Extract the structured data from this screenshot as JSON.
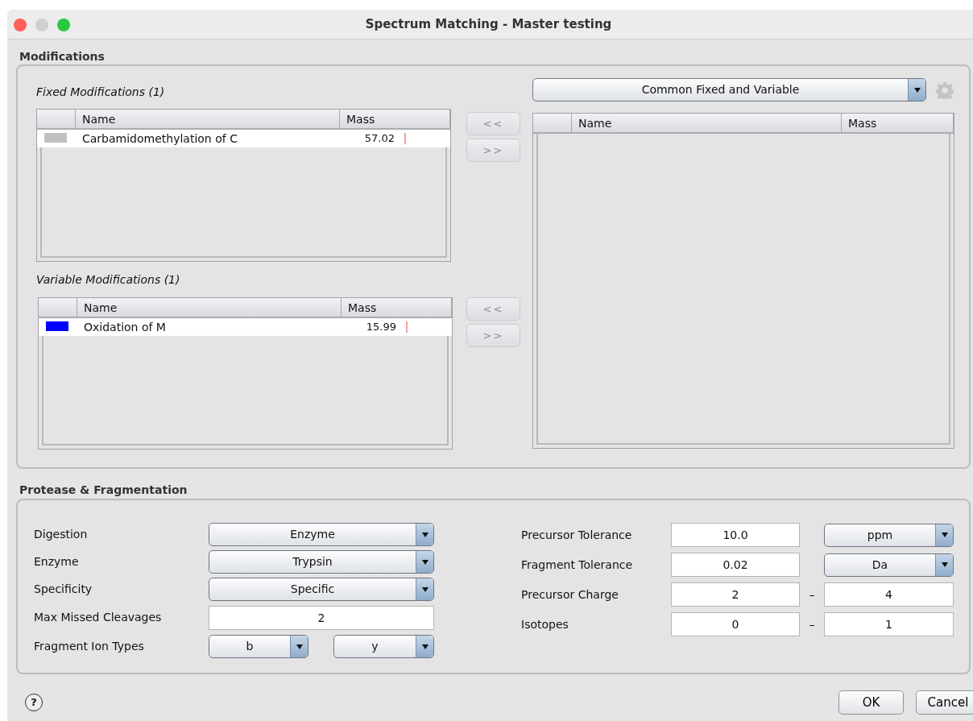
{
  "window": {
    "title": "Spectrum Matching - Master testing"
  },
  "modifications": {
    "title": "Modifications",
    "fixed": {
      "label": "Fixed Modifications (1)",
      "columns": [
        "Name",
        "Mass"
      ],
      "rows": [
        {
          "color": "#c0c0c0",
          "name": "Carbamidomethylation of C",
          "mass": "57.02"
        }
      ],
      "buttons": [
        {
          "label": "<<",
          "disabled": true
        },
        {
          "label": ">>",
          "disabled": true
        }
      ]
    },
    "variable": {
      "label": "Variable Modifications (1)",
      "columns": [
        "Name",
        "Mass"
      ],
      "rows": [
        {
          "color": "#0000ff",
          "name": "Oxidation of M",
          "mass": "15.99"
        }
      ],
      "buttons": [
        {
          "label": "<<",
          "disabled": true
        },
        {
          "label": ">>",
          "disabled": true
        }
      ]
    },
    "available": {
      "dropdown": "Common Fixed and Variable",
      "columns": [
        "Name",
        "Mass"
      ]
    }
  },
  "protease": {
    "title": "Protease & Fragmentation",
    "left": [
      {
        "kind": "combo",
        "label": "Digestion",
        "value": "Enzyme"
      },
      {
        "kind": "combo",
        "label": "Enzyme",
        "value": "Trypsin"
      },
      {
        "kind": "combo",
        "label": "Specificity",
        "value": "Specific"
      },
      {
        "kind": "field",
        "label": "Max Missed Cleavages",
        "value": "2"
      },
      {
        "kind": "pair",
        "label": "Fragment Ion Types",
        "values": [
          "b",
          "y"
        ]
      }
    ],
    "right": [
      {
        "kind": "unit",
        "label": "Precursor Tolerance",
        "value": "10.0",
        "unit": "ppm"
      },
      {
        "kind": "unit",
        "label": "Fragment Tolerance",
        "value": "0.02",
        "unit": "Da"
      },
      {
        "kind": "range",
        "label": "Precursor Charge",
        "from": "2",
        "separator": "–",
        "to": "4"
      },
      {
        "kind": "range",
        "label": "Isotopes",
        "from": "0",
        "separator": "–",
        "to": "1"
      }
    ]
  },
  "footer": {
    "help": "?",
    "buttons": [
      "OK",
      "Cancel"
    ]
  }
}
